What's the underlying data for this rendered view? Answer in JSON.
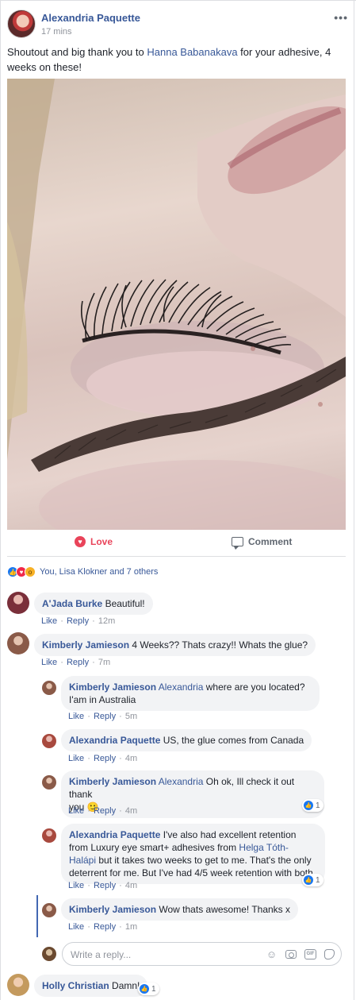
{
  "post": {
    "author": "Alexandria Paquette",
    "time": "17 mins",
    "more": "•••",
    "text_before": "Shoutout and big thank you to ",
    "mention": "Hanna Babanakava",
    "text_after": " for your adhesive, 4 weeks on these!"
  },
  "actions": {
    "love": "Love",
    "comment": "Comment"
  },
  "reactions": {
    "summary": "You, Lisa Klokner and 7 others",
    "icons": [
      "like-icon",
      "love-icon",
      "wow-icon"
    ]
  },
  "comments": [
    {
      "name": "A'Jada Burke",
      "text": "Beautiful!",
      "like": "Like",
      "reply": "Reply",
      "time": "12m"
    },
    {
      "name": "Kimberly Jamieson",
      "text": "4 Weeks?? Thats crazy!! Whats the glue?",
      "like": "Like",
      "reply": "Reply",
      "time": "7m"
    }
  ],
  "replies": [
    {
      "name": "Kimberly Jamieson",
      "mention": "Alexandria",
      "text_line1": " where are you located?",
      "text_line2": "I'am in Australia",
      "like": "Like",
      "reply": "Reply",
      "time": "5m"
    },
    {
      "name": "Alexandria Paquette",
      "text": "US, the glue comes from Canada",
      "like": "Like",
      "reply": "Reply",
      "time": "4m"
    },
    {
      "name": "Kimberly Jamieson",
      "mention": "Alexandria",
      "text_line1": " Oh ok, Ill check it out thank",
      "text_line2": "you",
      "emoji": "🙂",
      "like": "Like",
      "reply": "Reply",
      "time": "4m",
      "likes": "1"
    },
    {
      "name": "Alexandria Paquette",
      "text_line1": " I've also had excellent retention",
      "text_line2": "from Luxury eye smart+ adhesives from ",
      "mention": "Helga Tóth-",
      "mention_line2": "Halápi",
      "text_line3": " but it takes two weeks to get to me. That's the only",
      "text_line4": "deterrent for me. But I've had 4/5 week retention with both",
      "like": "Like",
      "reply": "Reply",
      "time": "4m",
      "likes": "1"
    },
    {
      "name": "Kimberly Jamieson",
      "text": "Wow thats awesome! Thanks x",
      "like": "Like",
      "reply": "Reply",
      "time": "1m"
    }
  ],
  "reply_box": {
    "placeholder": "Write a reply...",
    "icons": [
      "emoji-icon",
      "camera-icon",
      "gif-icon",
      "sticker-icon"
    ]
  },
  "last_comment": {
    "name": "Holly Christian",
    "text": "Damn!",
    "likes": "1"
  },
  "colors": {
    "link": "#385898",
    "love": "#e9445a",
    "like": "#1877f2",
    "bubble": "#f2f3f5",
    "meta": "#90949c"
  }
}
